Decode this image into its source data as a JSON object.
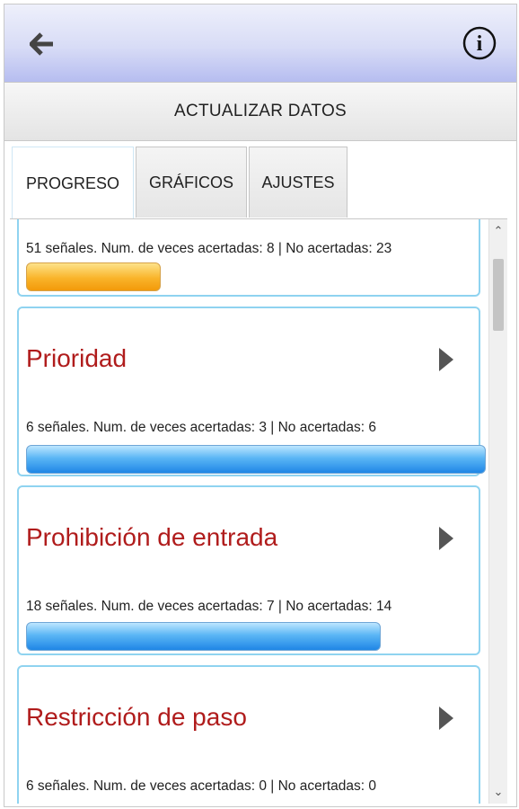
{
  "header": {
    "back_icon": "back-arrow-icon",
    "info_icon": "info-icon",
    "info_glyph": "i"
  },
  "update_bar": {
    "label": "ACTUALIZAR DATOS"
  },
  "tabs": [
    {
      "label": "PROGRESO",
      "active": true
    },
    {
      "label": "GRÁFICOS",
      "active": false
    },
    {
      "label": "AJUSTES",
      "active": false
    }
  ],
  "cards": [
    {
      "title": "",
      "stats": "51 señales. Num. de veces acertadas: 8 |  No acertadas: 23",
      "progress": 0.29,
      "bar_color": "#f39a0a"
    },
    {
      "title": "Prioridad",
      "stats": "6 señales. Num. de veces acertadas: 3 |  No acertadas: 6",
      "progress": 1.0,
      "bar_color": "#1f86e6"
    },
    {
      "title": "Prohibición de entrada",
      "stats": "18 señales. Num. de veces acertadas: 7 |  No acertadas: 14",
      "progress": 0.77,
      "bar_color": "#1f86e6"
    },
    {
      "title": "Restricción de paso",
      "stats": "6 señales. Num. de veces acertadas: 0 |  No acertadas: 0",
      "progress": 0,
      "bar_color": "#1f86e6"
    }
  ],
  "colors": {
    "title_red": "#b01c1c",
    "card_border": "#8fd3f0",
    "header_gradient_bottom": "#b6bdf0"
  },
  "scrollbar": {
    "up_glyph": "⌃",
    "down_glyph": "⌄"
  }
}
